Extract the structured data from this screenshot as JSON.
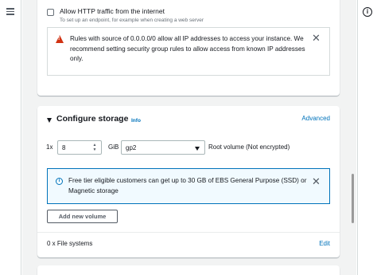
{
  "network": {
    "http_label": "Allow HTTP traffic from the internet",
    "http_sublabel": "To set up an endpoint, for example when creating a web server",
    "warning_text": "Rules with source of 0.0.0.0/0 allow all IP addresses to access your instance. We recommend setting security group rules to allow access from known IP addresses only."
  },
  "storage": {
    "title": "Configure storage",
    "info_link": "Info",
    "advanced_link": "Advanced",
    "volume_multiplier": "1x",
    "volume_size": "8",
    "size_unit": "GiB",
    "volume_type": "gp2",
    "root_volume_text": "Root volume  (Not encrypted)",
    "free_tier_text": "Free tier eligible customers can get up to 30 GB of EBS General Purpose (SSD) or Magnetic storage",
    "add_volume_label": "Add new volume",
    "file_systems_text": "0 x File systems",
    "edit_link": "Edit"
  },
  "colors": {
    "link": "#0073bb",
    "warning": "#d13212",
    "info_bg": "#f1faff",
    "page_bg": "#f2f3f3"
  },
  "icons": [
    "menu-icon",
    "info-circle-icon",
    "warning-icon",
    "close-icon",
    "caret-down-icon",
    "info-icon"
  ]
}
